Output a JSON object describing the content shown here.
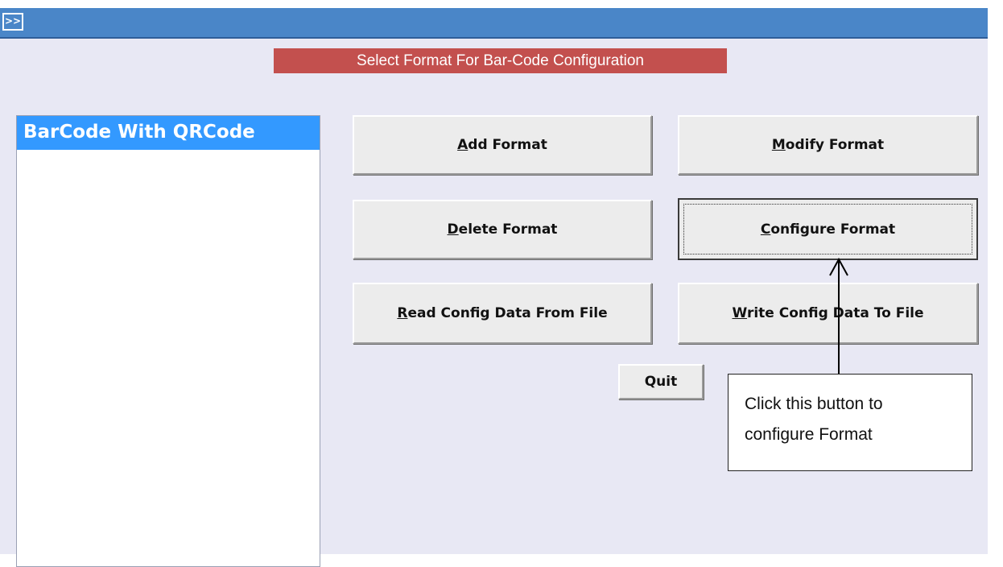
{
  "titlebar": {
    "nav_glyph": ">>"
  },
  "heading": "Select Format For Bar-Code Configuration",
  "formats_list": {
    "items": [
      "BarCode With QRCode"
    ],
    "selected": 0
  },
  "buttons": {
    "add": {
      "accel": "A",
      "rest": "dd Format"
    },
    "modify": {
      "accel": "M",
      "rest": "odify Format"
    },
    "delete": {
      "accel": "D",
      "rest": "elete Format"
    },
    "configure": {
      "accel": "C",
      "rest": "onfigure Format"
    },
    "read": {
      "accel": "R",
      "rest": "ead Config Data From File"
    },
    "write": {
      "accel": "W",
      "rest": "rite Config Data  To File"
    },
    "quit": "Quit"
  },
  "callout": {
    "line1": "Click this button to",
    "line2": "configure Format"
  },
  "colors": {
    "titlebar": "#4a86c8",
    "heading_bg": "#c3504e",
    "selection": "#3399ff",
    "form_bg": "#e8e8f4"
  }
}
